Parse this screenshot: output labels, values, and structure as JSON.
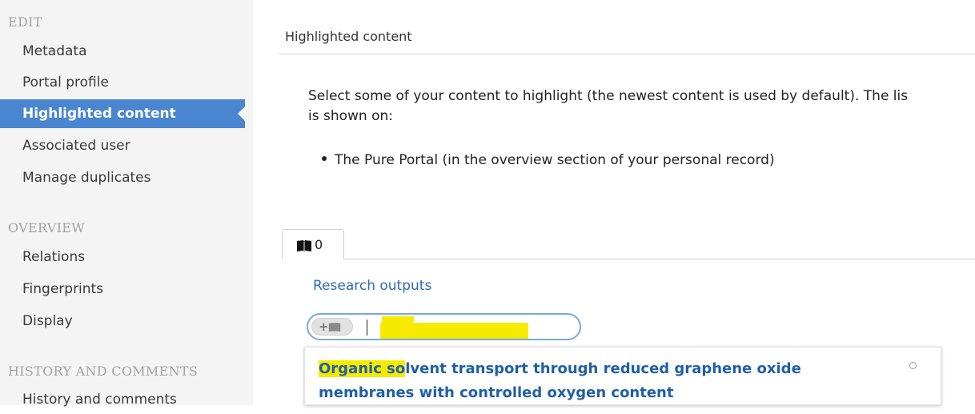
{
  "sidebar": {
    "sections": [
      {
        "title": "EDIT",
        "items": [
          "Metadata",
          "Portal profile",
          "Highlighted content",
          "Associated user",
          "Manage duplicates"
        ]
      },
      {
        "title": "OVERVIEW",
        "items": [
          "Relations",
          "Fingerprints",
          "Display"
        ]
      },
      {
        "title": "HISTORY AND COMMENTS",
        "items": [
          "History and comments"
        ]
      }
    ],
    "active_item": "Highlighted content"
  },
  "main": {
    "title": "Highlighted content",
    "description_line1": "Select some of your content to highlight (the newest content is used by default). The lis",
    "description_line2": "is shown on:",
    "bullet": "The Pure Portal (in the overview section of your personal record)",
    "tab": {
      "icon": "book-icon",
      "count": "0"
    },
    "section_label": "Research outputs",
    "search": {
      "value": "",
      "add_icon": "add-book-icon"
    },
    "result": {
      "title_highlight": "Organic so",
      "title_rest": "lvent transport through reduced graphene oxide membranes with controlled oxygen content"
    }
  },
  "colors": {
    "active_nav_bg": "#4a86d0",
    "link_blue": "#1f5fa8",
    "highlight_yellow": "#f5ea00",
    "search_border": "#79a9df"
  }
}
